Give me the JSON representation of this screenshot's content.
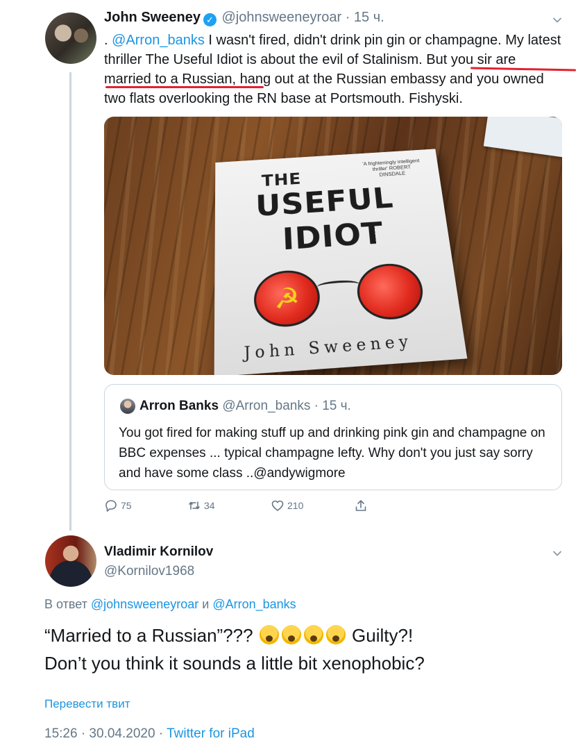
{
  "tweet1": {
    "name": "John Sweeney",
    "handle": "@johnsweeneyroar",
    "time": "15 ч.",
    "text_prefix": ". ",
    "mention": "@Arron_banks",
    "text_part1": " I wasn't fired, didn't drink pin gin or champagne. My latest thriller The Useful Idiot is about the evil of Stalinism. But you sir are married to a Russian, hang out at the Russian embassy and you owned two flats overlooking the RN base at Portsmouth. Fishyski.",
    "book": {
      "quote": "'A frighteningly intelligent thriller' ROBERT DINSDALE",
      "the": "THE",
      "title_line1": "USEFUL",
      "title_line2": "IDIOT",
      "author": "John Sweeney"
    },
    "quoted": {
      "name": "Arron Banks",
      "handle": "@Arron_banks",
      "time": "15 ч.",
      "text": "You got fired for making stuff up and drinking pink gin and champagne on BBC expenses ... typical champagne lefty. Why don't you just say sorry and have some class ..@andywigmore"
    },
    "actions": {
      "replies": "75",
      "retweets": "34",
      "likes": "210"
    }
  },
  "tweet2": {
    "name": "Vladimir Kornilov",
    "handle": "@Kornilov1968",
    "reply_prefix": "В ответ ",
    "reply_mention1": "@johnsweeneyroar",
    "reply_and": " и ",
    "reply_mention2": "@Arron_banks",
    "text_line1a": "“Married to a Russian”??? ",
    "text_line1b": " Guilty?!",
    "text_line2": "Don’t you think it sounds a little bit xenophobic?",
    "translate": "Перевести твит",
    "datetime": "15:26 · 30.04.2020 · ",
    "source": "Twitter for iPad"
  },
  "colors": {
    "link": "#1b95e0",
    "muted": "#657786",
    "underline": "#e3212f"
  },
  "icons": [
    "verified-badge-icon",
    "chevron-down-icon",
    "reply-icon",
    "retweet-icon",
    "like-icon",
    "share-icon",
    "face-screaming-emoji"
  ]
}
